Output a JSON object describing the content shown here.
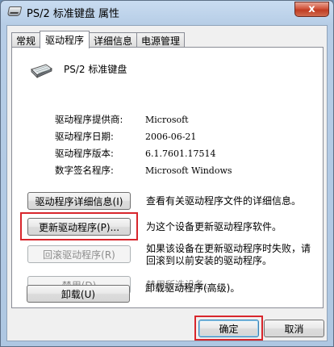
{
  "window": {
    "title": "PS/2 标准键盘 属性",
    "close_label": "x"
  },
  "tabs": [
    {
      "label": "常规",
      "active": false
    },
    {
      "label": "驱动程序",
      "active": true
    },
    {
      "label": "详细信息",
      "active": false
    },
    {
      "label": "电源管理",
      "active": false
    }
  ],
  "device": {
    "name": "PS/2 标准键盘",
    "icon": "keyboard-icon"
  },
  "info": [
    {
      "label": "驱动程序提供商:",
      "value": "Microsoft"
    },
    {
      "label": "驱动程序日期:",
      "value": "2006-06-21"
    },
    {
      "label": "驱动程序版本:",
      "value": "6.1.7601.17514"
    },
    {
      "label": "数字签名程序:",
      "value": "Microsoft Windows"
    }
  ],
  "actions": [
    {
      "label": "驱动程序详细信息(I)",
      "desc": "查看有关驱动程序文件的详细信息。",
      "enabled": true
    },
    {
      "label": "更新驱动程序(P)...",
      "desc": "为这个设备更新驱动程序软件。",
      "enabled": true
    },
    {
      "label": "回滚驱动程序(R)",
      "desc_line1": "如果该设备在更新驱动程序时失败，请",
      "desc_line2": "回滚到以前安装的驱动程序。",
      "enabled": false
    },
    {
      "label": "禁用(D)",
      "desc": "禁用所选设备。",
      "enabled": false
    },
    {
      "label": "卸载(U)",
      "desc": "卸载驱动程序(高级)。",
      "enabled": true
    }
  ],
  "footer": {
    "ok_label": "确定",
    "cancel_label": "取消"
  },
  "colors": {
    "highlight": "#d8262c"
  }
}
